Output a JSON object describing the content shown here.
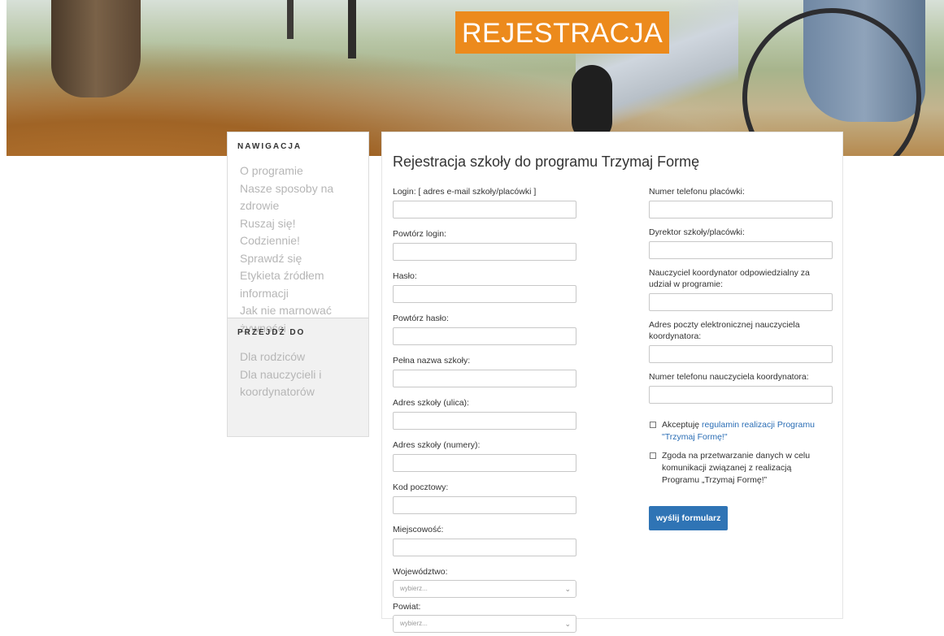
{
  "header": {
    "title": "REJESTRACJA"
  },
  "sidebar": {
    "nav_heading": "NAWIGACJA",
    "nav_items": [
      "O programie",
      "Nasze sposoby na zdrowie",
      "Ruszaj się! Codziennie!",
      "Sprawdź się",
      "Etykieta źródłem informacji",
      "Jak nie marnować żywności"
    ],
    "goto_heading": "PRZEJDŹ DO",
    "goto_items": [
      "Dla rodziców",
      "Dla nauczycieli i koordynatorów"
    ]
  },
  "form": {
    "heading": "Rejestracja szkoły do programu Trzymaj Formę",
    "left_fields": [
      {
        "label": "Login: [ adres e-mail szkoły/placówki ]",
        "value": ""
      },
      {
        "label": "Powtórz login:",
        "value": ""
      },
      {
        "label": "Hasło:",
        "value": ""
      },
      {
        "label": "Powtórz hasło:",
        "value": ""
      },
      {
        "label": "Pełna nazwa szkoły:",
        "value": ""
      },
      {
        "label": "Adres szkoły (ulica):",
        "value": ""
      },
      {
        "label": "Adres szkoły (numery):",
        "value": ""
      },
      {
        "label": "Kod pocztowy:",
        "value": ""
      },
      {
        "label": "Miejscowość:",
        "value": ""
      }
    ],
    "selects": [
      {
        "label": "Województwo:",
        "value": "wybierz..."
      },
      {
        "label": "Powiat:",
        "value": "wybierz..."
      }
    ],
    "right_fields": [
      {
        "label": "Numer telefonu placówki:",
        "value": ""
      },
      {
        "label": "Dyrektor szkoły/placówki:",
        "value": ""
      },
      {
        "label": "Nauczyciel koordynator odpowiedzialny za udział w programie:",
        "value": ""
      },
      {
        "label": "Adres poczty elektronicznej nauczyciela koordynatora:",
        "value": ""
      },
      {
        "label": "Numer telefonu nauczyciela koordynatora:",
        "value": ""
      }
    ],
    "consent1_prefix": "Akceptuję ",
    "consent1_link": "regulamin realizacji Programu \"Trzymaj Formę!\"",
    "consent2": "Zgoda na przetwarzanie danych w celu komunikacji związanej z realizacją Programu „Trzymaj Formę!”",
    "submit_label": "wyślij formularz"
  }
}
